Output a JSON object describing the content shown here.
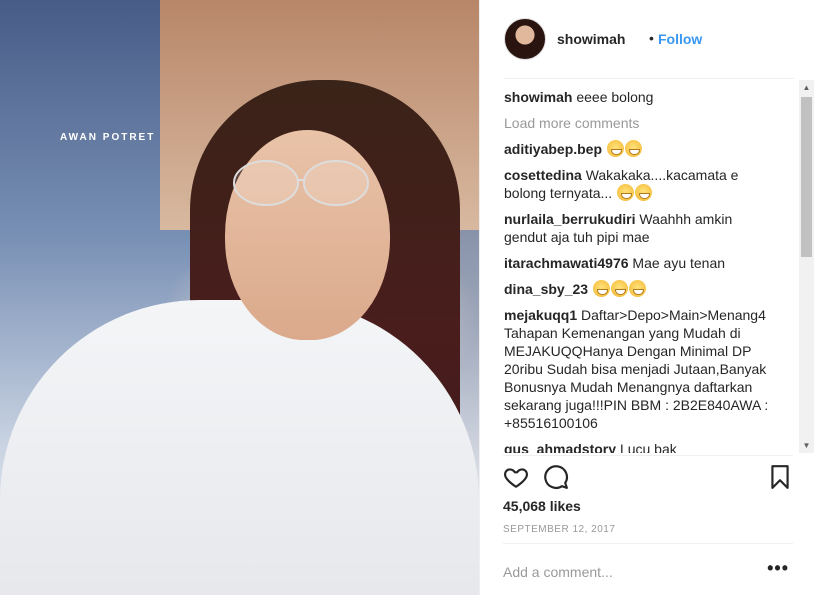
{
  "photo": {
    "watermark": "AWAN POTRET"
  },
  "header": {
    "username": "showimah",
    "separator": "•",
    "follow_label": "Follow"
  },
  "comments": {
    "caption": {
      "user": "showimah",
      "text": "eeee bolong"
    },
    "load_more": "Load more comments",
    "items": [
      {
        "user": "aditiyabep.bep",
        "text": "",
        "emoji": 2
      },
      {
        "user": "cosettedina",
        "text": "Wakakaka....kacamata e bolong ternyata...",
        "emoji": 2
      },
      {
        "user": "nurlaila_berrukudiri",
        "text": "Waahhh amkin gendut aja tuh pipi mae",
        "emoji": 0
      },
      {
        "user": "itarachmawati4976",
        "text": "Mae ayu tenan",
        "emoji": 0
      },
      {
        "user": "dina_sby_23",
        "text": "",
        "emoji": 3
      },
      {
        "user": "mejakuqq1",
        "text": "Daftar>Depo>Main>Menang4 Tahapan Kemenangan yang Mudah di MEJAKUQQHanya Dengan Minimal DP 20ribu Sudah bisa menjadi Jutaan,Banyak Bonusnya Mudah Menangnya daftarkan sekarang juga!!!PIN BBM : 2B2E840AWA : +85516100106",
        "emoji": 0
      },
      {
        "user": "gus_ahmadstory",
        "text": "Lucu bak",
        "emoji": 0
      }
    ]
  },
  "scrollbar": {
    "up": "▲",
    "down": "▼"
  },
  "actions": {
    "heart_icon": "heart-icon",
    "comment_icon": "comment-icon",
    "bookmark_icon": "bookmark-icon"
  },
  "likes": "45,068 likes",
  "date": "SEPTEMBER 12, 2017",
  "add_comment": {
    "placeholder": "Add a comment...",
    "more": "•••"
  }
}
